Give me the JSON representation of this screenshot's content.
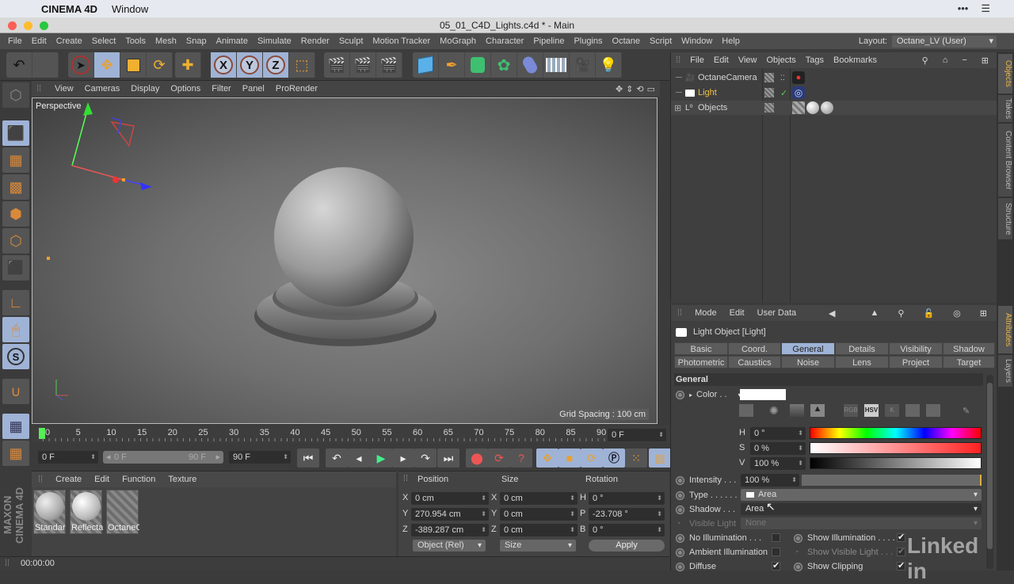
{
  "mac_menu": {
    "app": "CINEMA 4D",
    "items": [
      "Window"
    ]
  },
  "window": {
    "title": "05_01_C4D_Lights.c4d * - Main"
  },
  "main_menu": [
    "File",
    "Edit",
    "Create",
    "Select",
    "Tools",
    "Mesh",
    "Snap",
    "Animate",
    "Simulate",
    "Render",
    "Sculpt",
    "Motion Tracker",
    "MoGraph",
    "Character",
    "Pipeline",
    "Plugins",
    "Octane",
    "Script",
    "Window",
    "Help"
  ],
  "layout": {
    "label": "Layout:",
    "value": "Octane_LV (User)"
  },
  "toolbar": {
    "axis_x": "X",
    "axis_y": "Y",
    "axis_z": "Z"
  },
  "viewport": {
    "menu": [
      "View",
      "Cameras",
      "Display",
      "Options",
      "Filter",
      "Panel",
      "ProRender"
    ],
    "camera_label": "Perspective",
    "grid_spacing": "Grid Spacing : 100 cm"
  },
  "timeline": {
    "ticks": [
      "0",
      "5",
      "10",
      "15",
      "20",
      "25",
      "30",
      "35",
      "40",
      "45",
      "50",
      "55",
      "60",
      "65",
      "70",
      "75",
      "80",
      "85",
      "90"
    ],
    "current_frame": "0 F",
    "start_field": "0 F",
    "range_start": "0 F",
    "range_end": "90 F",
    "end_field": "90 F"
  },
  "material_manager": {
    "menu": [
      "Create",
      "Edit",
      "Function",
      "Texture"
    ],
    "materials": [
      {
        "name": "Standar",
        "type": "sphere"
      },
      {
        "name": "Reflecta",
        "type": "sphere"
      },
      {
        "name": "OctaneG",
        "type": "empty"
      }
    ]
  },
  "coordinates": {
    "headers": {
      "position": "Position",
      "size": "Size",
      "rotation": "Rotation"
    },
    "position": [
      {
        "axis": "X",
        "value": "0 cm"
      },
      {
        "axis": "Y",
        "value": "270.954 cm"
      },
      {
        "axis": "Z",
        "value": "-389.287 cm"
      }
    ],
    "size": [
      {
        "axis": "X",
        "value": "0 cm"
      },
      {
        "axis": "Y",
        "value": "0 cm"
      },
      {
        "axis": "Z",
        "value": "0 cm"
      }
    ],
    "rotation": [
      {
        "axis": "H",
        "value": "0 °"
      },
      {
        "axis": "P",
        "value": "-23.708 °"
      },
      {
        "axis": "B",
        "value": "0 °"
      }
    ],
    "mode_select": "Object (Rel)",
    "size_select": "Size",
    "apply_label": "Apply"
  },
  "status": {
    "time": "00:00:00"
  },
  "brand": {
    "maxon": "MAXON CINEMA 4D",
    "linkedin": "Linked in"
  },
  "object_manager": {
    "menu": [
      "File",
      "Edit",
      "View",
      "Objects",
      "Tags",
      "Bookmarks"
    ],
    "objects": [
      {
        "name": "OctaneCamera",
        "selected": false,
        "color": "#d6d6d6"
      },
      {
        "name": "Light",
        "selected": true,
        "color": "#f0c040"
      },
      {
        "name": "Objects",
        "selected": false,
        "color": "#d6d6d6"
      }
    ]
  },
  "side_tabs": {
    "top": [
      "Objects",
      "Takes",
      "Content Browser",
      "Structure"
    ],
    "bottom": [
      "Attributes",
      "Layers"
    ]
  },
  "attributes": {
    "menu": [
      "Mode",
      "Edit",
      "User Data"
    ],
    "object_title": "Light Object [Light]",
    "tabs_row1": [
      "Basic",
      "Coord.",
      "General",
      "Details",
      "Visibility",
      "Shadow"
    ],
    "tabs_row2": [
      "Photometric",
      "Caustics",
      "Noise",
      "Lens",
      "Project",
      "Target"
    ],
    "active_tab": "General",
    "section": "General",
    "color_label": "Color . .",
    "color_value": "#ffffff",
    "color_modes": [
      "RGB",
      "HSV",
      "K"
    ],
    "hsv": [
      {
        "label": "H",
        "value": "0 °"
      },
      {
        "label": "S",
        "value": "0 %"
      },
      {
        "label": "V",
        "value": "100 %"
      }
    ],
    "intensity": {
      "label": "Intensity . . .",
      "value": "100 %",
      "fraction": 1.0
    },
    "type": {
      "label": "Type . . . . . .",
      "value": "Area"
    },
    "shadow": {
      "label": "Shadow . . .",
      "value": "Area"
    },
    "visible_light": {
      "label": "Visible Light",
      "value": "None"
    },
    "checks_left": [
      {
        "label": "No Illumination . . .",
        "checked": false
      },
      {
        "label": "Ambient Illumination",
        "checked": false
      },
      {
        "label": "Diffuse",
        "checked": true
      }
    ],
    "checks_right": [
      {
        "label": "Show Illumination . . . .",
        "checked": true
      },
      {
        "label": "Show Visible Light . . .",
        "checked": true
      },
      {
        "label": "Show Clipping",
        "checked": true
      }
    ]
  }
}
